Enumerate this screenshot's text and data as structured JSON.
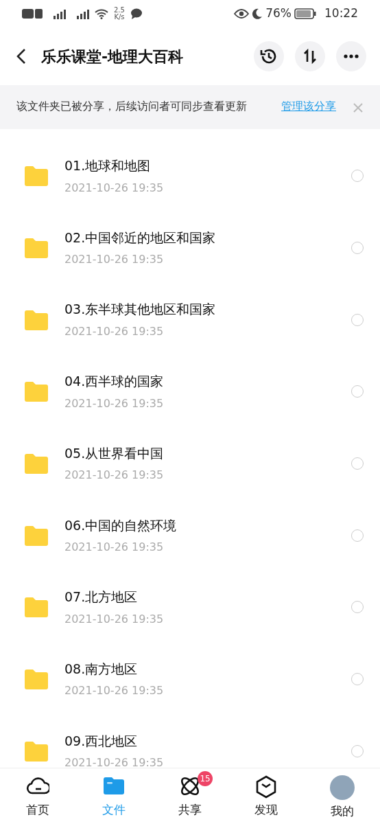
{
  "status_bar": {
    "speed": "2.5",
    "speed_unit": "K/s",
    "battery": "76%",
    "time": "10:22"
  },
  "header": {
    "title": "乐乐课堂-地理大百科"
  },
  "banner": {
    "text": "该文件夹已被分享，后续访问者可同步查看更新",
    "link": "管理该分享"
  },
  "files": [
    {
      "name": "01.地球和地图",
      "date": "2021-10-26  19:35",
      "selected": false
    },
    {
      "name": "02.中国邻近的地区和国家",
      "date": "2021-10-26  19:35",
      "selected": false
    },
    {
      "name": "03.东半球其他地区和国家",
      "date": "2021-10-26  19:35",
      "selected": false
    },
    {
      "name": "04.西半球的国家",
      "date": "2021-10-26  19:35",
      "selected": false
    },
    {
      "name": "05.从世界看中国",
      "date": "2021-10-26  19:35",
      "selected": false
    },
    {
      "name": "06.中国的自然环境",
      "date": "2021-10-26  19:35",
      "selected": false
    },
    {
      "name": "07.北方地区",
      "date": "2021-10-26  19:35",
      "selected": false
    },
    {
      "name": "08.南方地区",
      "date": "2021-10-26  19:35",
      "selected": false
    },
    {
      "name": "09.西北地区",
      "date": "2021-10-26  19:35",
      "selected": false
    }
  ],
  "tabs": [
    {
      "label": "首页",
      "kind": "cloud",
      "selected": false
    },
    {
      "label": "文件",
      "kind": "folder",
      "selected": true
    },
    {
      "label": "共享",
      "kind": "orbit",
      "selected": false,
      "badge": "15"
    },
    {
      "label": "发现",
      "kind": "cube",
      "selected": false
    },
    {
      "label": "我的",
      "kind": "avatar",
      "selected": false
    }
  ]
}
